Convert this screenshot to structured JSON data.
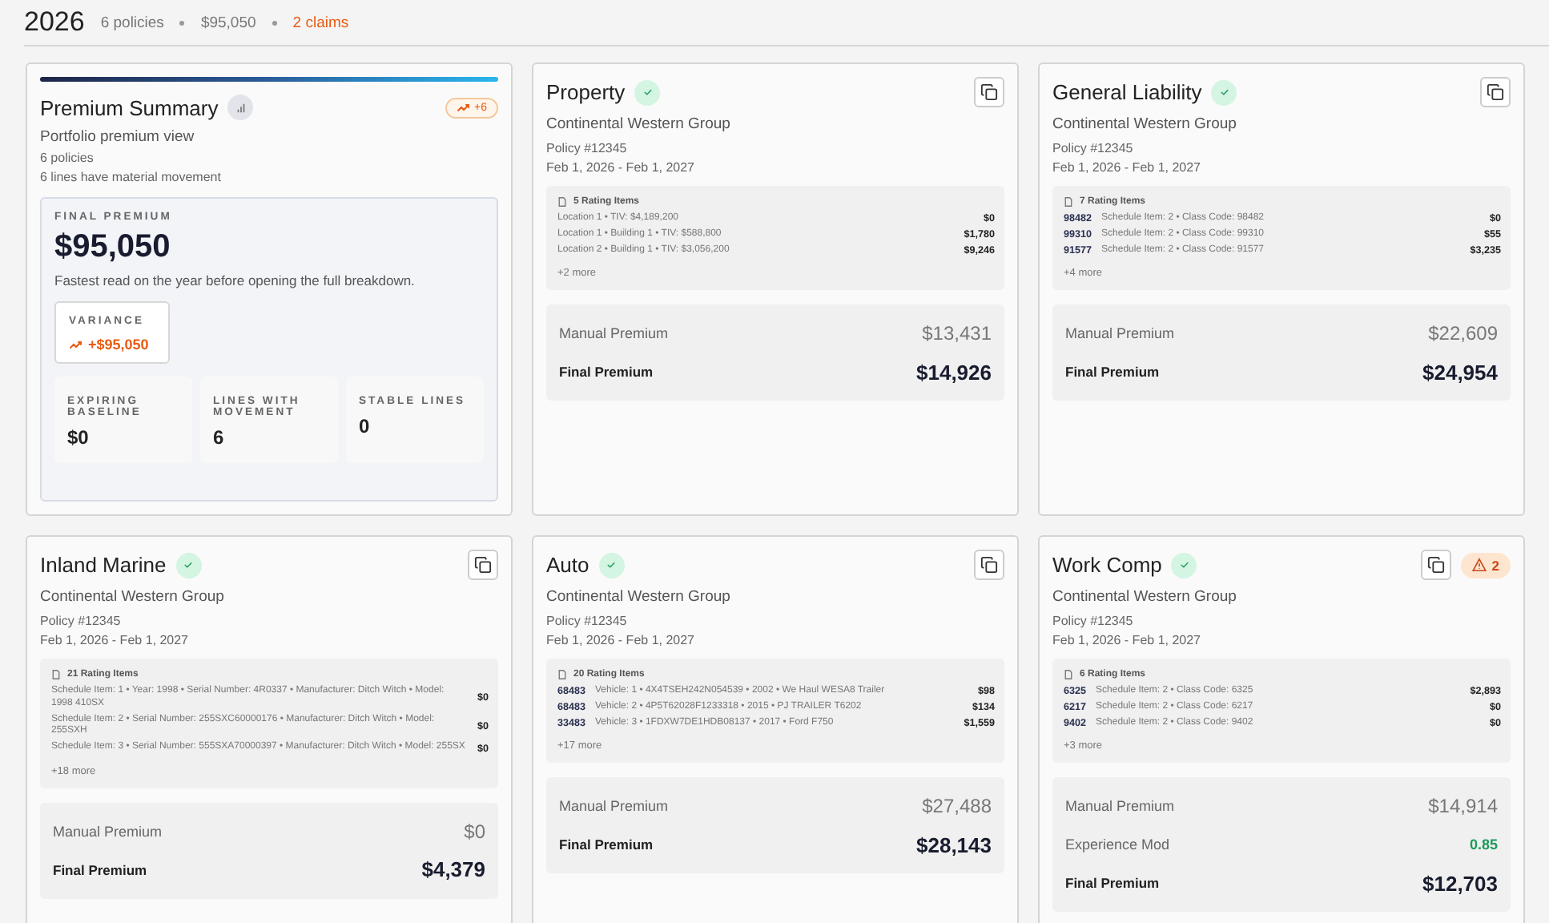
{
  "header": {
    "year": "2026",
    "stats": [
      {
        "text": "6 policies",
        "kind": "plain"
      },
      {
        "text": "$95,050",
        "kind": "plain"
      },
      {
        "text": "2 claims",
        "kind": "alert"
      }
    ]
  },
  "summary": {
    "title": "Premium Summary",
    "badge": "+6",
    "subtitle": "Portfolio premium view",
    "notes": [
      "6 policies",
      "6 lines have material movement"
    ],
    "final_label": "FINAL PREMIUM",
    "final_value": "$95,050",
    "description": "Fastest read on the year before opening the full breakdown.",
    "variance": {
      "label": "VARIANCE",
      "value": "+$95,050"
    },
    "stats": [
      {
        "label": "EXPIRING BASELINE",
        "value": "$0"
      },
      {
        "label": "LINES WITH MOVEMENT",
        "value": "6"
      },
      {
        "label": "STABLE LINES",
        "value": "0"
      }
    ]
  },
  "policies": [
    {
      "title": "Property",
      "verified": true,
      "carrier": "Continental Western Group",
      "policy": "Policy #12345",
      "dates": "Feb 1, 2026 - Feb 1, 2027",
      "rating_title": "5 Rating Items",
      "items": [
        {
          "text": "Location 1 • TIV: $4,189,200",
          "amount": "$0"
        },
        {
          "text": "Location 1 • Building 1 • TIV: $588,800",
          "amount": "$1,780"
        },
        {
          "text": "Location 2 • Building 1 • TIV: $3,056,200",
          "amount": "$9,246"
        }
      ],
      "more": "+2 more",
      "premiums": [
        {
          "kind": "manual",
          "label": "Manual Premium",
          "value": "$13,431"
        },
        {
          "kind": "final",
          "label": "Final Premium",
          "value": "$14,926"
        }
      ]
    },
    {
      "title": "General Liability",
      "verified": true,
      "carrier": "Continental Western Group",
      "policy": "Policy #12345",
      "dates": "Feb 1, 2026 - Feb 1, 2027",
      "rating_title": "7 Rating Items",
      "items": [
        {
          "code": "98482",
          "text": "Schedule Item: 2 • Class Code: 98482",
          "amount": "$0"
        },
        {
          "code": "99310",
          "text": "Schedule Item: 2 • Class Code: 99310",
          "amount": "$55"
        },
        {
          "code": "91577",
          "text": "Schedule Item: 2 • Class Code: 91577",
          "amount": "$3,235"
        }
      ],
      "more": "+4 more",
      "premiums": [
        {
          "kind": "manual",
          "label": "Manual Premium",
          "value": "$22,609"
        },
        {
          "kind": "final",
          "label": "Final Premium",
          "value": "$24,954"
        }
      ]
    },
    {
      "title": "Inland Marine",
      "verified": true,
      "carrier": "Continental Western Group",
      "policy": "Policy #12345",
      "dates": "Feb 1, 2026 - Feb 1, 2027",
      "rating_title": "21 Rating Items",
      "items": [
        {
          "text": "Schedule Item: 1 • Year: 1998 • Serial Number: 4R0337 • Manufacturer: Ditch Witch • Model: 1998 410SX",
          "amount": "$0"
        },
        {
          "text": "Schedule Item: 2 • Serial Number: 255SXC60000176 • Manufacturer: Ditch Witch • Model: 255SXH",
          "amount": "$0"
        },
        {
          "text": "Schedule Item: 3 • Serial Number: 555SXA70000397 • Manufacturer: Ditch Witch • Model: 255SX",
          "amount": "$0"
        }
      ],
      "more": "+18 more",
      "premiums": [
        {
          "kind": "manual",
          "label": "Manual Premium",
          "value": "$0"
        },
        {
          "kind": "final",
          "label": "Final Premium",
          "value": "$4,379"
        }
      ]
    },
    {
      "title": "Auto",
      "verified": true,
      "carrier": "Continental Western Group",
      "policy": "Policy #12345",
      "dates": "Feb 1, 2026 - Feb 1, 2027",
      "rating_title": "20 Rating Items",
      "items": [
        {
          "code": "68483",
          "text": "Vehicle: 1 • 4X4TSEH242N054539 • 2002 • We Haul WESA8 Trailer",
          "amount": "$98"
        },
        {
          "code": "68483",
          "text": "Vehicle: 2 • 4P5T62028F1233318 • 2015 • PJ TRAILER T6202",
          "amount": "$134"
        },
        {
          "code": "33483",
          "text": "Vehicle: 3 • 1FDXW7DE1HDB08137 • 2017 • Ford F750",
          "amount": "$1,559"
        }
      ],
      "more": "+17 more",
      "premiums": [
        {
          "kind": "manual",
          "label": "Manual Premium",
          "value": "$27,488"
        },
        {
          "kind": "final",
          "label": "Final Premium",
          "value": "$28,143"
        }
      ]
    },
    {
      "title": "Work Comp",
      "verified": true,
      "carrier": "Continental Western Group",
      "policy": "Policy #12345",
      "dates": "Feb 1, 2026 - Feb 1, 2027",
      "alert": "2",
      "rating_title": "6 Rating Items",
      "items": [
        {
          "code": "6325",
          "text": "Schedule Item: 2 • Class Code: 6325",
          "amount": "$2,893"
        },
        {
          "code": "6217",
          "text": "Schedule Item: 2 • Class Code: 6217",
          "amount": "$0"
        },
        {
          "code": "9402",
          "text": "Schedule Item: 2 • Class Code: 9402",
          "amount": "$0"
        }
      ],
      "more": "+3 more",
      "premiums": [
        {
          "kind": "manual",
          "label": "Manual Premium",
          "value": "$14,914"
        },
        {
          "kind": "mod",
          "label": "Experience Mod",
          "value": "0.85"
        },
        {
          "kind": "final",
          "label": "Final Premium",
          "value": "$12,703"
        }
      ]
    }
  ]
}
